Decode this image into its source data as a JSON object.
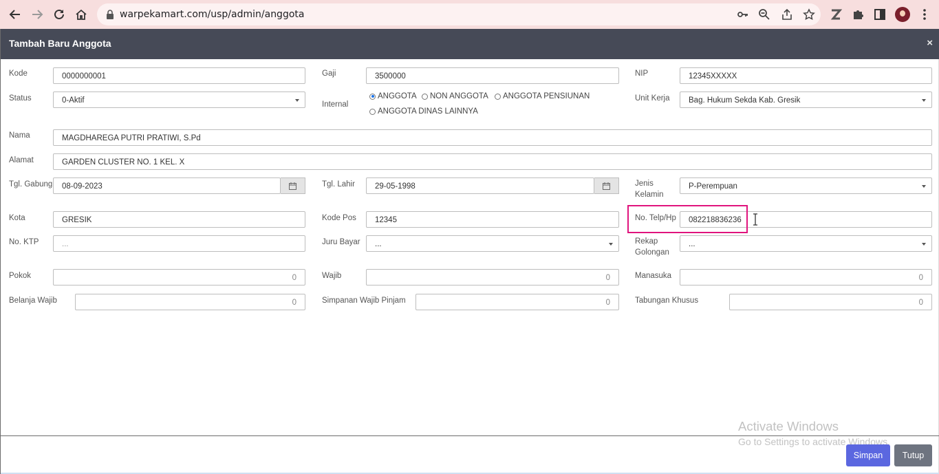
{
  "browser": {
    "url": "warpekamart.com/usp/admin/anggota"
  },
  "modal": {
    "title": "Tambah Baru Anggota",
    "close_glyph": "×"
  },
  "form": {
    "kode": {
      "label": "Kode",
      "value": "0000000001"
    },
    "gaji": {
      "label": "Gaji",
      "value": "3500000"
    },
    "nip": {
      "label": "NIP",
      "value": "12345XXXXX"
    },
    "status": {
      "label": "Status",
      "value": "0-Aktif"
    },
    "internal": {
      "label": "Internal",
      "options": [
        "ANGGOTA",
        "NON ANGGOTA",
        "ANGGOTA PENSIUNAN",
        "ANGGOTA DINAS LAINNYA"
      ],
      "selected": "ANGGOTA"
    },
    "unit_kerja": {
      "label": "Unit Kerja",
      "value": "Bag. Hukum Sekda Kab. Gresik"
    },
    "nama": {
      "label": "Nama",
      "value": "MAGDHAREGA PUTRI PRATIWI, S.Pd"
    },
    "alamat": {
      "label": "Alamat",
      "value": "GARDEN CLUSTER NO. 1 KEL. X"
    },
    "tgl_gabung": {
      "label": "Tgl. Gabung",
      "value": "08-09-2023"
    },
    "tgl_lahir": {
      "label": "Tgl. Lahir",
      "value": "29-05-1998"
    },
    "jenis_kelamin": {
      "label": "Jenis Kelamin",
      "value": "P-Perempuan"
    },
    "kota": {
      "label": "Kota",
      "value": "GRESIK"
    },
    "kode_pos": {
      "label": "Kode Pos",
      "value": "12345"
    },
    "no_telp": {
      "label": "No. Telp/Hp",
      "value": "082218836236"
    },
    "no_ktp": {
      "label": "No. KTP",
      "placeholder": "..."
    },
    "juru_bayar": {
      "label": "Juru Bayar",
      "value": "..."
    },
    "rekap_golongan": {
      "label": "Rekap Golongan",
      "value": "..."
    },
    "pokok": {
      "label": "Pokok",
      "value": "0"
    },
    "wajib": {
      "label": "Wajib",
      "value": "0"
    },
    "manasuka": {
      "label": "Manasuka",
      "value": "0"
    },
    "belanja_wajib": {
      "label": "Belanja Wajib",
      "value": "0"
    },
    "simpanan_wajib_pinjam": {
      "label": "Simpanan Wajib Pinjam",
      "value": "0"
    },
    "tabungan_khusus": {
      "label": "Tabungan Khusus",
      "value": "0"
    }
  },
  "footer": {
    "save_label": "Simpan",
    "close_label": "Tutup",
    "watermark_title": "Activate Windows",
    "watermark_sub": "Go to Settings to activate Windows."
  },
  "colors": {
    "header": "#464a57",
    "primary": "#5b67e0",
    "secondary": "#6e7480",
    "highlight": "#e0137d",
    "browser_bar": "#f7dede"
  }
}
